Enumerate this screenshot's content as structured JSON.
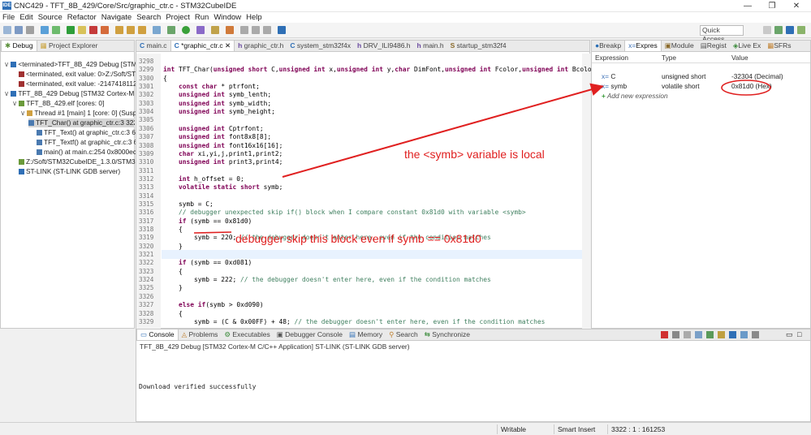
{
  "window": {
    "title": "CNC429 - TFT_8B_429/Core/Src/graphic_ctr.c - STM32CubeIDE",
    "app_icon": "IDE"
  },
  "menu": [
    "File",
    "Edit",
    "Source",
    "Refactor",
    "Navigate",
    "Search",
    "Project",
    "Run",
    "Window",
    "Help"
  ],
  "quick_access": {
    "placeholder": "Quick Access"
  },
  "debug_tabs": {
    "debug": "Debug",
    "project_explorer": "Project Explorer"
  },
  "debug_tree": [
    "<terminated>TFT_8B_429 Debug [STM32",
    "<terminated, exit value: 0>Z:/Soft/STM",
    "<terminated, exit value: -2147418112:",
    "TFT_8B_429 Debug [STM32 Cortex-M C/C",
    "TFT_8B_429.elf [cores: 0]",
    "Thread #1 [main] 1 [core: 0] (Suspe",
    "TFT_Char() at graphic_ctr.c:3 322",
    "TFT_Text() at graphic_ctr.c:3 659",
    "TFT_Textf() at graphic_ctr.c:3 627",
    "main() at main.c:254 0x8000ec2",
    "Z:/Soft/STM32CubeIDE_1.3.0/STM32C",
    "ST-LINK (ST-LINK GDB server)"
  ],
  "editor_tabs": [
    "main.c",
    "*graphic_ctr.c",
    "graphic_ctr.h",
    "system_stm32f4x",
    "DRV_ILI9486.h",
    "main.h",
    "startup_stm32f4"
  ],
  "code_lines": [
    {
      "n": "3298",
      "t": ""
    },
    {
      "n": "3299",
      "t": "int TFT_Char(unsigned short C,unsigned int x,unsigned int y,char DimFont,unsigned int Fcolor,unsigned int Bcolo"
    },
    {
      "n": "3300",
      "t": "{"
    },
    {
      "n": "3301",
      "t": "    const char * ptrfont;"
    },
    {
      "n": "3302",
      "t": "    unsigned int symb_lenth;"
    },
    {
      "n": "3303",
      "t": "    unsigned int symb_width;"
    },
    {
      "n": "3304",
      "t": "    unsigned int symb_height;"
    },
    {
      "n": "3305",
      "t": ""
    },
    {
      "n": "3306",
      "t": "    unsigned int Cptrfont;"
    },
    {
      "n": "3307",
      "t": "    unsigned int font8x8[8];"
    },
    {
      "n": "3308",
      "t": "    unsigned int font16x16[16];"
    },
    {
      "n": "3309",
      "t": "    char xi,yi,j,print1,print2;"
    },
    {
      "n": "3310",
      "t": "    unsigned int print3,print4;"
    },
    {
      "n": "3311",
      "t": ""
    },
    {
      "n": "3312",
      "t": "    int h_offset = 0;"
    },
    {
      "n": "3313",
      "t": "    volatile static short symb;"
    },
    {
      "n": "3314",
      "t": ""
    },
    {
      "n": "3315",
      "t": "    symb = C;"
    },
    {
      "n": "3316",
      "t": "    // debugger unexpected skip if() block when I compare constant 0x81d0 with variable <symb>"
    },
    {
      "n": "3317",
      "t": "    if (symb == 0x81d0)"
    },
    {
      "n": "3318",
      "t": "    {"
    },
    {
      "n": "3319",
      "t": "        symb = 220; // the debugger doesn't enter here, even if the condition matches"
    },
    {
      "n": "3320",
      "t": "    }"
    },
    {
      "n": "3321",
      "t": ""
    },
    {
      "n": "3322",
      "t": "    if (symb == 0xd081)"
    },
    {
      "n": "3323",
      "t": "    {"
    },
    {
      "n": "3324",
      "t": "        symb = 222; // the debugger doesn't enter here, even if the condition matches"
    },
    {
      "n": "3325",
      "t": "    }"
    },
    {
      "n": "3326",
      "t": ""
    },
    {
      "n": "3327",
      "t": "    else if(symb > 0xd090)"
    },
    {
      "n": "3328",
      "t": "    {"
    },
    {
      "n": "3329",
      "t": "        symb = (C & 0x00FF) + 48; // the debugger doesn't enter here, even if the condition matches"
    }
  ],
  "expr_tabs": [
    "Breakp",
    "Expres",
    "Module",
    "Regist",
    "Live Ex",
    "SFRs"
  ],
  "expr_headers": {
    "expression": "Expression",
    "type": "Type",
    "value": "Value"
  },
  "expressions": [
    {
      "name": "C",
      "type": "unsigned short",
      "value": "-32304 (Decimal)"
    },
    {
      "name": "symb",
      "type": "volatile short",
      "value": "0x81d0 (Hex)"
    }
  ],
  "add_expression": "Add new expression",
  "console_tabs": [
    "Console",
    "Problems",
    "Executables",
    "Debugger Console",
    "Memory",
    "Search",
    "Synchronize"
  ],
  "console": {
    "header": "TFT_8B_429 Debug [STM32 Cortex-M C/C++ Application] ST-LINK (ST-LINK GDB server)",
    "output": "Download verified successfully"
  },
  "status": {
    "writable": "Writable",
    "insert": "Smart Insert",
    "position": "3322 : 1 : 161253"
  },
  "annotations": {
    "local_note": "the <symb> variable is local",
    "skip_note": "debugger skip this block even if symb == 0x81d0"
  },
  "colors": {
    "annotation": "#e02020",
    "keyword": "#7f0055",
    "comment": "#3f7f5f"
  }
}
